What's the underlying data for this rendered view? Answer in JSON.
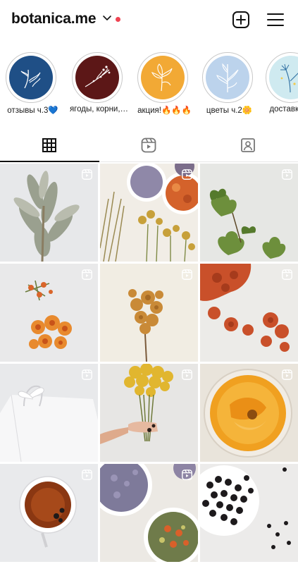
{
  "header": {
    "username": "botanica.me"
  },
  "highlights": [
    {
      "label": "отзывы ч.3💙",
      "bg": "#1f4f86"
    },
    {
      "label": "ягоды, корни,…",
      "bg": "#5c1717"
    },
    {
      "label": "акция!🔥🔥🔥",
      "bg": "#f2a935"
    },
    {
      "label": "цветы ч.2🌼",
      "bg": "#bcd3ec"
    },
    {
      "label": "доставка, …",
      "bg": "#cfeaf0"
    }
  ],
  "tabs": [
    {
      "name": "posts"
    },
    {
      "name": "reels"
    },
    {
      "name": "tagged"
    }
  ],
  "colors": {
    "accent": "#ef4352",
    "text": "#111111",
    "divider": "#e6e6e6"
  }
}
